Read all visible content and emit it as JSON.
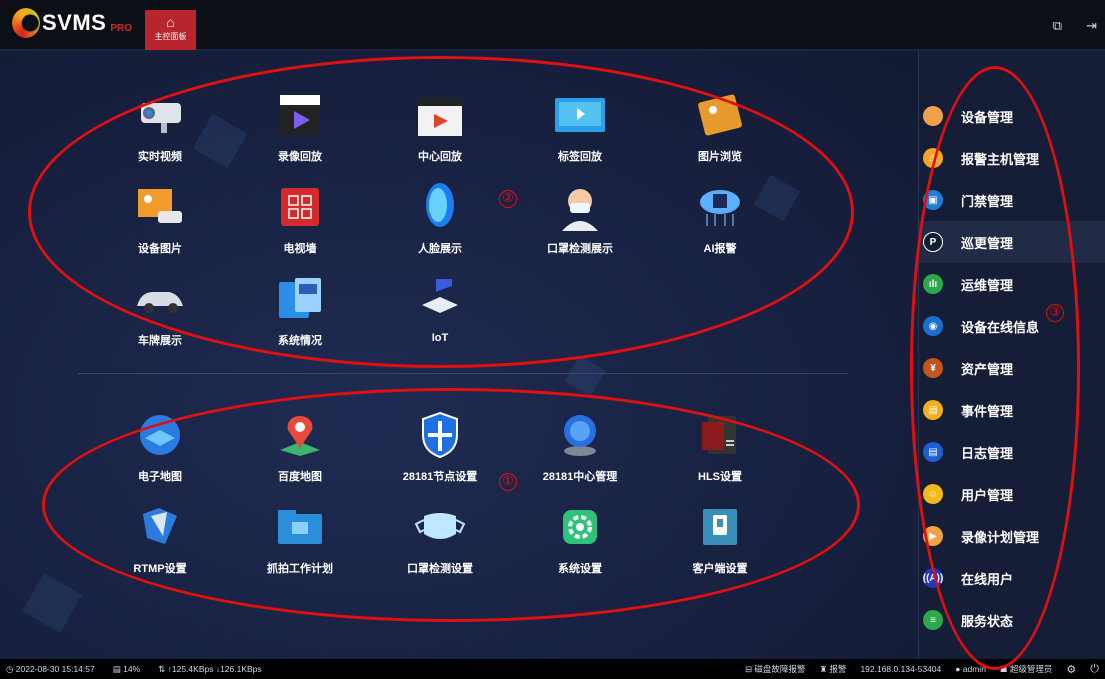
{
  "app": {
    "logo_text": "SVMS",
    "logo_pro": "PRO",
    "home_tab": "主控面板"
  },
  "apps_top": [
    {
      "label": "实时视频",
      "icon": "camera-icon"
    },
    {
      "label": "录像回放",
      "icon": "video-playback-icon"
    },
    {
      "label": "中心回放",
      "icon": "clapperboard-icon"
    },
    {
      "label": "标签回放",
      "icon": "tag-playback-icon"
    },
    {
      "label": "图片浏览",
      "icon": "picture-icon"
    },
    {
      "label": "设备图片",
      "icon": "device-picture-icon"
    },
    {
      "label": "电视墙",
      "icon": "tv-wall-icon"
    },
    {
      "label": "人脸展示",
      "icon": "face-icon"
    },
    {
      "label": "口罩检测展示",
      "icon": "mask-person-icon"
    },
    {
      "label": "AI报警",
      "icon": "ai-cloud-icon"
    },
    {
      "label": "车牌展示",
      "icon": "car-icon"
    },
    {
      "label": "系统情况",
      "icon": "system-status-icon"
    },
    {
      "label": "IoT",
      "icon": "iot-icon"
    }
  ],
  "apps_bottom": [
    {
      "label": "电子地图",
      "icon": "emap-icon"
    },
    {
      "label": "百度地图",
      "icon": "map-pin-icon"
    },
    {
      "label": "28181节点设置",
      "icon": "shield-icon"
    },
    {
      "label": "28181中心管理",
      "icon": "globe-icon"
    },
    {
      "label": "HLS设置",
      "icon": "server-icon"
    },
    {
      "label": "RTMP设置",
      "icon": "rtmp-icon"
    },
    {
      "label": "抓拍工作计划",
      "icon": "folder-icon"
    },
    {
      "label": "口罩检测设置",
      "icon": "mask-icon"
    },
    {
      "label": "系统设置",
      "icon": "gear-icon"
    },
    {
      "label": "客户端设置",
      "icon": "client-icon"
    }
  ],
  "sidebar": [
    {
      "label": "设备管理",
      "glyph": "",
      "color": "#f0a24a"
    },
    {
      "label": "报警主机管理",
      "glyph": "⚠",
      "color": "#f5a623"
    },
    {
      "label": "门禁管理",
      "glyph": "▣",
      "color": "#1e7fd6"
    },
    {
      "label": "巡更管理",
      "glyph": "P",
      "color": "#151d37"
    },
    {
      "label": "运维管理",
      "glyph": "ılı",
      "color": "#2aa84a"
    },
    {
      "label": "设备在线信息",
      "glyph": "◉",
      "color": "#1a6fd0"
    },
    {
      "label": "资产管理",
      "glyph": "¥",
      "color": "#c2551d"
    },
    {
      "label": "事件管理",
      "glyph": "▤",
      "color": "#f2b01e"
    },
    {
      "label": "日志管理",
      "glyph": "▤",
      "color": "#1e5fd6"
    },
    {
      "label": "用户管理",
      "glyph": "☺",
      "color": "#f2b81e"
    },
    {
      "label": "录像计划管理",
      "glyph": "▶",
      "color": "#f0a24a"
    },
    {
      "label": "在线用户",
      "glyph": "((A))",
      "color": "#2135c9"
    },
    {
      "label": "服务状态",
      "glyph": "≡",
      "color": "#2aa84a"
    }
  ],
  "annotations": [
    "②",
    "①",
    "③"
  ],
  "status": {
    "datetime": "2022-08-30 15:14:57",
    "cpu": "14%",
    "network": "↑125.4KBps ↓126.1KBps",
    "disk_alarm": "磁盘故障报警",
    "alarm": "报警",
    "address": "192.168.0.134-53404",
    "user": "admin",
    "role": "超级管理员"
  }
}
